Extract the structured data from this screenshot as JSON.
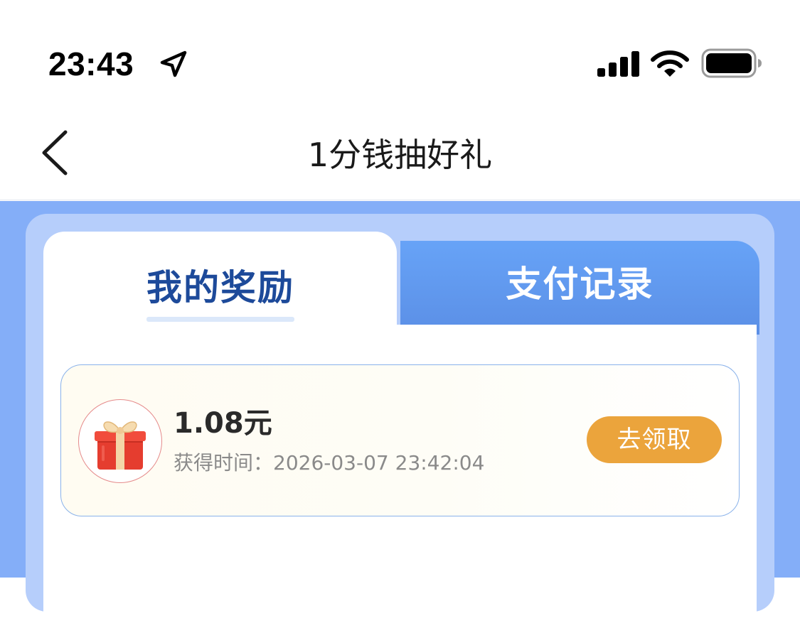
{
  "status_bar": {
    "time": "23:43"
  },
  "nav": {
    "title": "1分钱抽好礼"
  },
  "tabs": [
    {
      "label": "我的奖励",
      "active": true
    },
    {
      "label": "支付记录",
      "active": false
    }
  ],
  "rewards": [
    {
      "amount": "1.08元",
      "time_label": "获得时间：2026-03-07 23:42:04",
      "action_label": "去领取"
    }
  ],
  "colors": {
    "background_blue": "#84aef8",
    "panel_light_blue": "#b6cefb",
    "active_tab_text": "#1d4a9a",
    "claim_button": "#eba43c",
    "card_border": "#8ab2ea"
  },
  "icons": {
    "location": "location-arrow-icon",
    "signal": "cellular-signal-icon",
    "wifi": "wifi-icon",
    "battery": "battery-icon",
    "back": "chevron-left-icon",
    "gift": "gift-icon"
  }
}
